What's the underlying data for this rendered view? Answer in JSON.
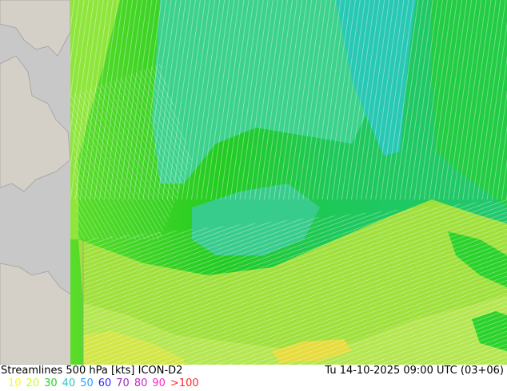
{
  "title": "Streamlines 500 hPa [kts] ICON-D2",
  "valid_time": "Tu 14-10-2025 09:00 UTC (03+06)",
  "legend": [
    {
      "label": "10",
      "color": "#ffff00"
    },
    {
      "label": "20",
      "color": "#c8ff28"
    },
    {
      "label": "30",
      "color": "#2ad22a"
    },
    {
      "label": "40",
      "color": "#28c8c8"
    },
    {
      "label": "50",
      "color": "#28a0ff"
    },
    {
      "label": "60",
      "color": "#2828ff"
    },
    {
      "label": "70",
      "color": "#a028c8"
    },
    {
      "label": "80",
      "color": "#c828c8"
    },
    {
      "label": "90",
      "color": "#ff28c8"
    },
    {
      "label": ">100",
      "color": "#ff2828"
    }
  ],
  "colors": {
    "land": "#d4d0c8",
    "sea": "#c8c8c8",
    "coast": "#a0a0a0"
  }
}
